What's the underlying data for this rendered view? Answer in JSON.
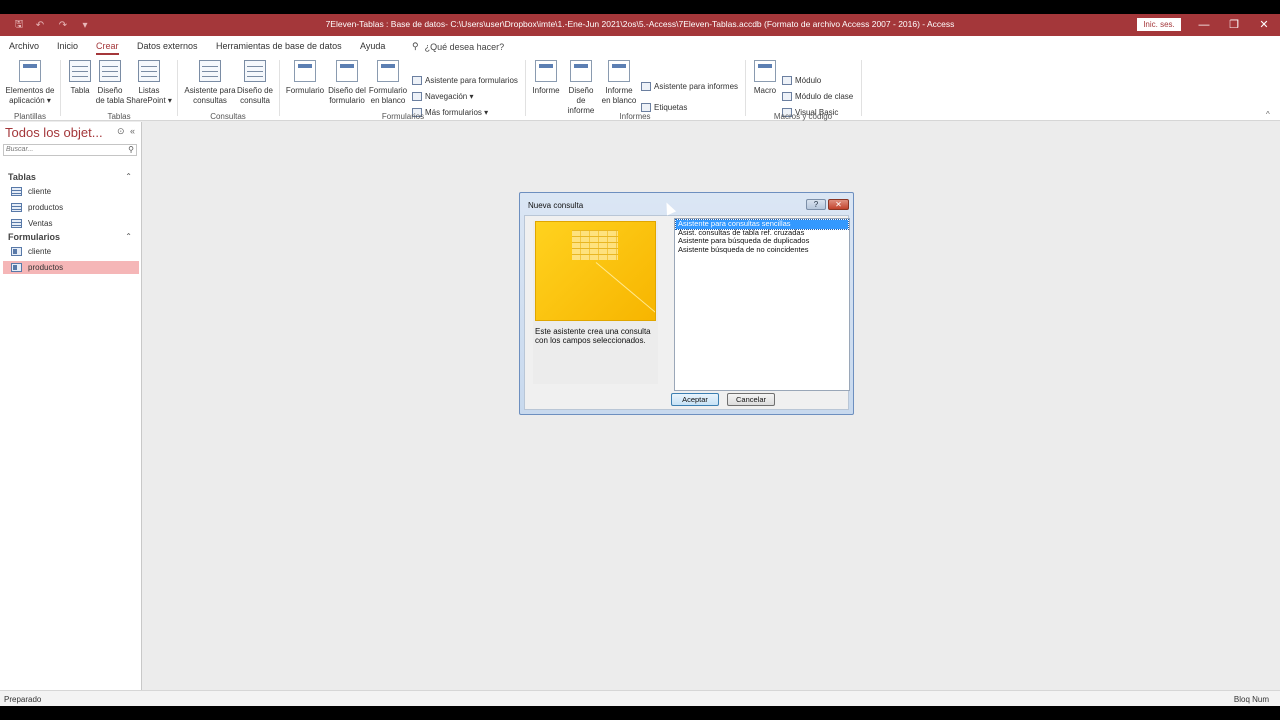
{
  "window": {
    "title": "7Eleven-Tablas : Base de datos- C:\\Users\\user\\Dropbox\\imte\\1.-Ene-Jun 2021\\2os\\5.-Access\\7Eleven-Tablas.accdb (Formato de archivo Access 2007 - 2016)  -  Access",
    "sign_in": "Inic. ses.",
    "minimize": "—",
    "restore": "❐",
    "close": "✕"
  },
  "qat": {
    "save": "🖫",
    "undo": "↶",
    "redo": "↷",
    "customize": "▾"
  },
  "tabs": [
    {
      "label": "Archivo"
    },
    {
      "label": "Inicio"
    },
    {
      "label": "Crear"
    },
    {
      "label": "Datos externos"
    },
    {
      "label": "Herramientas de base de datos"
    },
    {
      "label": "Ayuda"
    }
  ],
  "tell_me": {
    "icon": "⚲",
    "label": "¿Qué desea hacer?"
  },
  "ribbon": {
    "plantillas": {
      "btn1": "Elementos de",
      "btn2": "aplicación ▾",
      "group": "Plantillas"
    },
    "tablas": {
      "tabla": "Tabla",
      "diseno1": "Diseño",
      "diseno2": "de tabla",
      "listas1": "Listas",
      "listas2": "SharePoint ▾",
      "group": "Tablas"
    },
    "consultas": {
      "asist1": "Asistente para",
      "asist2": "consultas",
      "diseno1": "Diseño de",
      "diseno2": "consulta",
      "group": "Consultas"
    },
    "formularios": {
      "formulario": "Formulario",
      "diseno1": "Diseño del",
      "diseno2": "formulario",
      "blanco1": "Formulario",
      "blanco2": "en blanco",
      "asistente": "Asistente para formularios",
      "navegacion": "Navegación ▾",
      "mas": "Más formularios ▾",
      "group": "Formularios"
    },
    "informes": {
      "informe": "Informe",
      "diseno1": "Diseño de",
      "diseno2": "informe",
      "blanco1": "Informe",
      "blanco2": "en blanco",
      "asistente": "Asistente para informes",
      "etiquetas": "Etiquetas",
      "group": "Informes"
    },
    "macros": {
      "macro": "Macro",
      "modulo": "Módulo",
      "modulo_clase": "Módulo de clase",
      "vb": "Visual Basic",
      "group": "Macros y código"
    },
    "collapse_icon": "^"
  },
  "nav": {
    "title": "Todos los objet...",
    "dropdown_icon": "⊙",
    "shutter_icon": "«",
    "search_placeholder": "Buscar...",
    "search_icon": "⚲",
    "sections": [
      {
        "label": "Tablas",
        "chev": "⌃",
        "items": [
          "cliente",
          "productos",
          "Ventas"
        ]
      },
      {
        "label": "Formularios",
        "chev": "⌃",
        "items": [
          "cliente",
          "productos"
        ]
      }
    ]
  },
  "dialog": {
    "title": "Nueva consulta",
    "help": "?",
    "close": "✕",
    "description": "Este asistente crea una consulta con los campos seleccionados.",
    "options": [
      "Asistente para consultas sencillas",
      "Asist. consultas de tabla ref. cruzadas",
      "Asistente para búsqueda de duplicados",
      "Asistente búsqueda de no coincidentes"
    ],
    "selected_index": 0,
    "ok": "Aceptar",
    "cancel": "Cancelar"
  },
  "status": {
    "left": "Preparado",
    "right": "Bloq Num"
  },
  "colors": {
    "accent": "#a4373a",
    "selection": "#3399ff",
    "nav_selected": "#f5b6b7"
  }
}
